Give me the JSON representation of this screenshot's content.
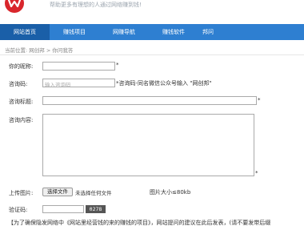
{
  "header": {
    "slogan": "帮助更多有理想的人通过网络赚到钱!"
  },
  "nav": {
    "items": [
      {
        "label": "网站首页",
        "active": true
      },
      {
        "label": "赚钱项目",
        "active": false
      },
      {
        "label": "网赚导航",
        "active": false
      },
      {
        "label": "赚钱软件",
        "active": false
      },
      {
        "label": "邦问",
        "active": false
      }
    ]
  },
  "breadcrumb": "当前位置: 网创邦 > 你问我答",
  "form": {
    "nickname_label": "你的昵称:",
    "nickname_required": "*",
    "invite_label": "咨询码:",
    "invite_placeholder": "输入咨询码",
    "invite_hint": "*咨询码-同名微信公众号输入 \"网创邦\"",
    "title_label": "咨询标题:",
    "title_required": "*",
    "content_label": "咨询内容:",
    "content_required": "*",
    "upload_label": "上传图片:",
    "upload_button": "选择文件",
    "upload_status": "未选择任何文件",
    "upload_size_hint": "图片大小≤80kb",
    "captcha_label": "验证码:",
    "captcha_code": "0278"
  },
  "footer_note": "【为了确保隐发网络中《网站里经营钱的来的赚钱的项目》，网站提问的建议在此后发表，(请不要发带后缀"
}
